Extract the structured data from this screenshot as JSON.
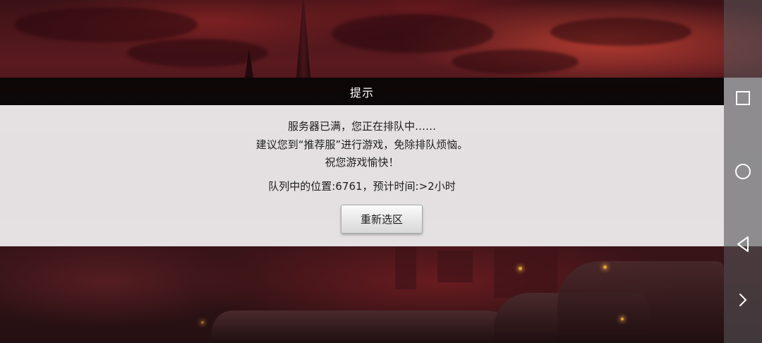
{
  "dialog": {
    "title": "提示",
    "messages": [
      "服务器已满，您正在排队中……",
      "建议您到“推荐服”进行游戏，免除排队烦恼。",
      "祝您游戏愉快！"
    ],
    "queue_info": "队列中的位置:6761，预计时间:>2小时",
    "reselect_button": "重新选区"
  },
  "nav_bar": {
    "buttons": [
      "recents-square-icon",
      "home-circle-icon",
      "back-triangle-icon",
      "expand-chevron-icon"
    ]
  },
  "colors": {
    "title_bar": "#080607",
    "dialog_body": "#eeeced",
    "text": "#1e1e1e",
    "nav_icon": "#ffffff"
  }
}
